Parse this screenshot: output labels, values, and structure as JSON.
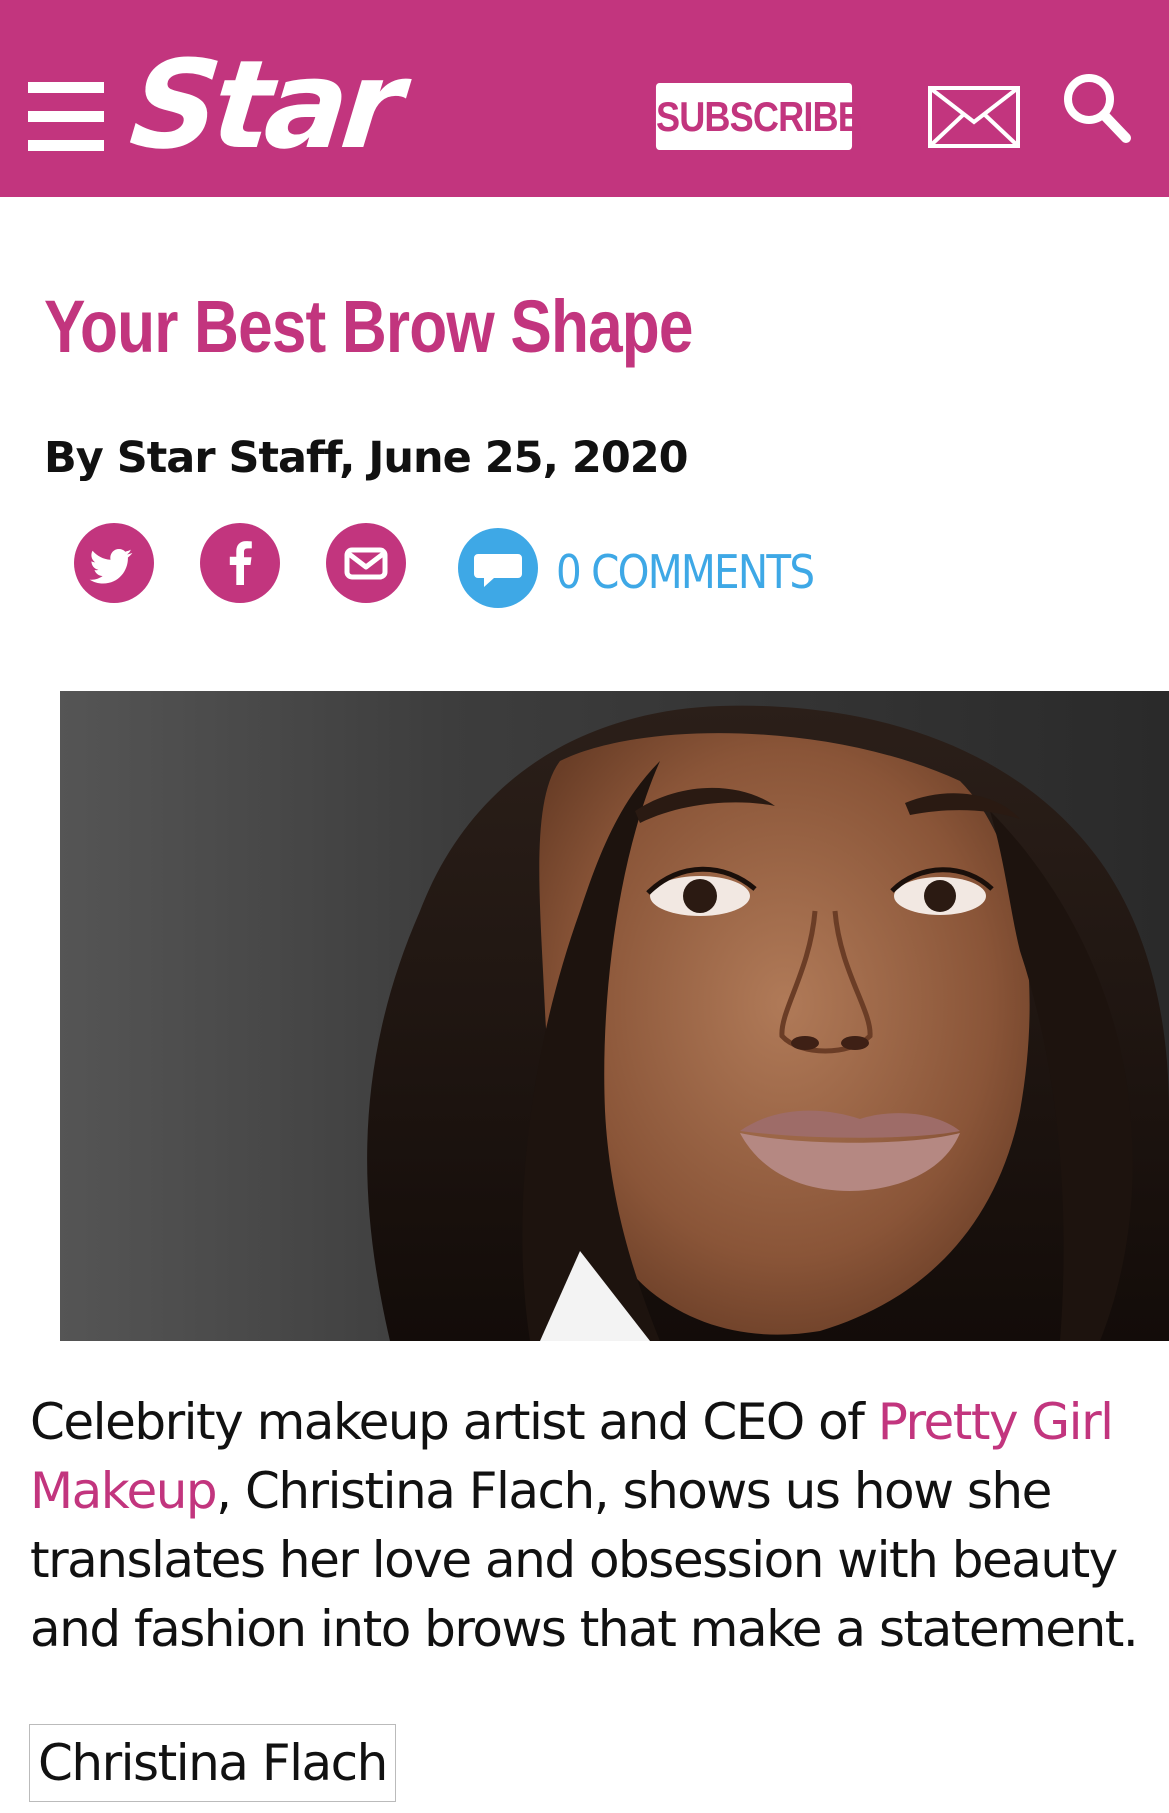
{
  "header": {
    "menu_icon": "hamburger-menu-icon",
    "logo_text": "Star",
    "subscribe_label": "SUBSCRIBE",
    "mail_icon": "envelope-icon",
    "search_icon": "search-icon",
    "brand_color": "#c2357e"
  },
  "article": {
    "title": "Your Best Brow Shape",
    "byline": "By Star Staff, June 25, 2020",
    "share": {
      "twitter_icon": "twitter-icon",
      "facebook_icon": "facebook-icon",
      "email_icon": "email-share-icon",
      "comments_icon": "comment-bubble-icon",
      "comments_label": "0 COMMENTS",
      "comments_color": "#3ea8e6"
    },
    "body": {
      "intro_before_link": "Celebrity makeup artist and CEO of ",
      "link_text": "Pretty Girl Makeup",
      "intro_after_link": ", Christina Flach, shows us how she translates her love and obsession with beauty and fashion into brows that make a statement."
    },
    "caption": "Christina Flach"
  }
}
